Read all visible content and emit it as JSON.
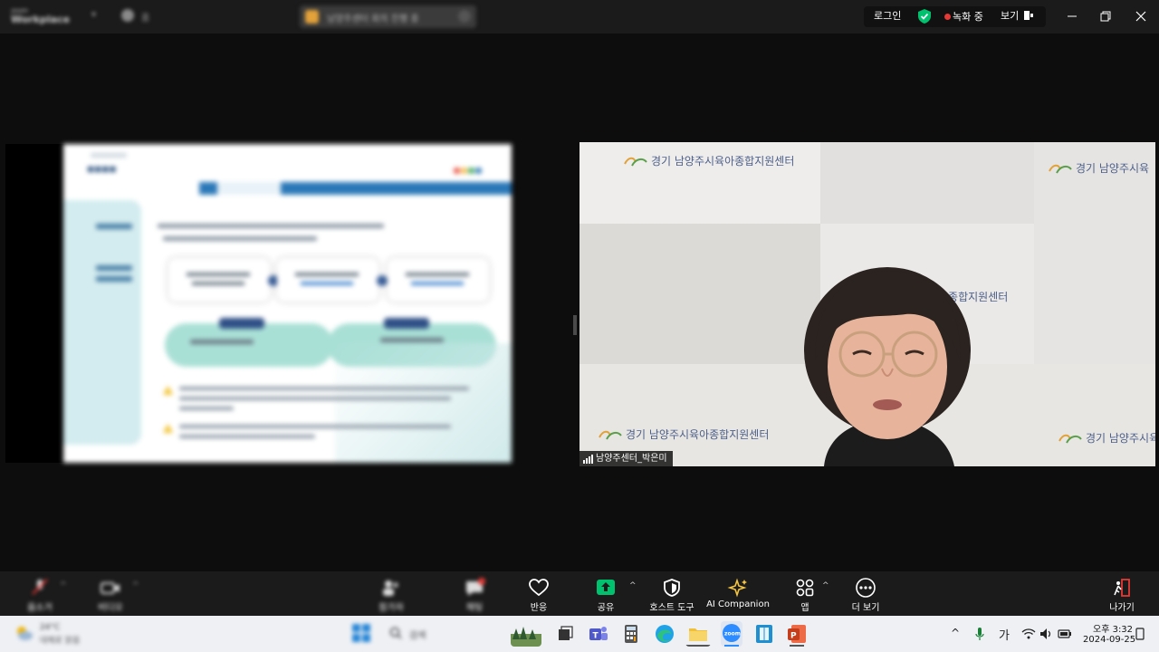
{
  "titlebar": {
    "workspace_small": "zoom",
    "workspace_name": "Workplace",
    "left_label": "홈",
    "meeting_pill_text": "남양주센터 회의 진행 중",
    "login": "로그인",
    "recording": "녹화 중",
    "view": "보기"
  },
  "video": {
    "participant_name": "남양주센터_박은미",
    "banner_text": "경기 남양주시육아종합지원센터",
    "banner_partial_1": "아종합지원센터",
    "banner_partial_2": "경기 남양주시육"
  },
  "toolbar": {
    "left_items": [
      {
        "label": "음소거"
      },
      {
        "label": "비디오"
      },
      {
        "label": "참가자"
      },
      {
        "label": "채팅"
      }
    ],
    "reactions": "반응",
    "share": "공유",
    "host_tools": "호스트 도구",
    "ai_companion": "AI Companion",
    "apps": "앱",
    "more": "더 보기",
    "leave": "나가기"
  },
  "taskbar": {
    "weather_temp": "24°C",
    "weather_desc": "대체로 맑음",
    "search_placeholder": "검색",
    "ime": "가",
    "time": "오후 3:32",
    "date": "2024-09-25"
  },
  "colors": {
    "accent_green": "#00c16e",
    "rec_red": "#e53935",
    "banner_blue": "#4c5f8a",
    "slide_blue": "#2a78b8",
    "slide_teal": "#a9e0d6"
  }
}
